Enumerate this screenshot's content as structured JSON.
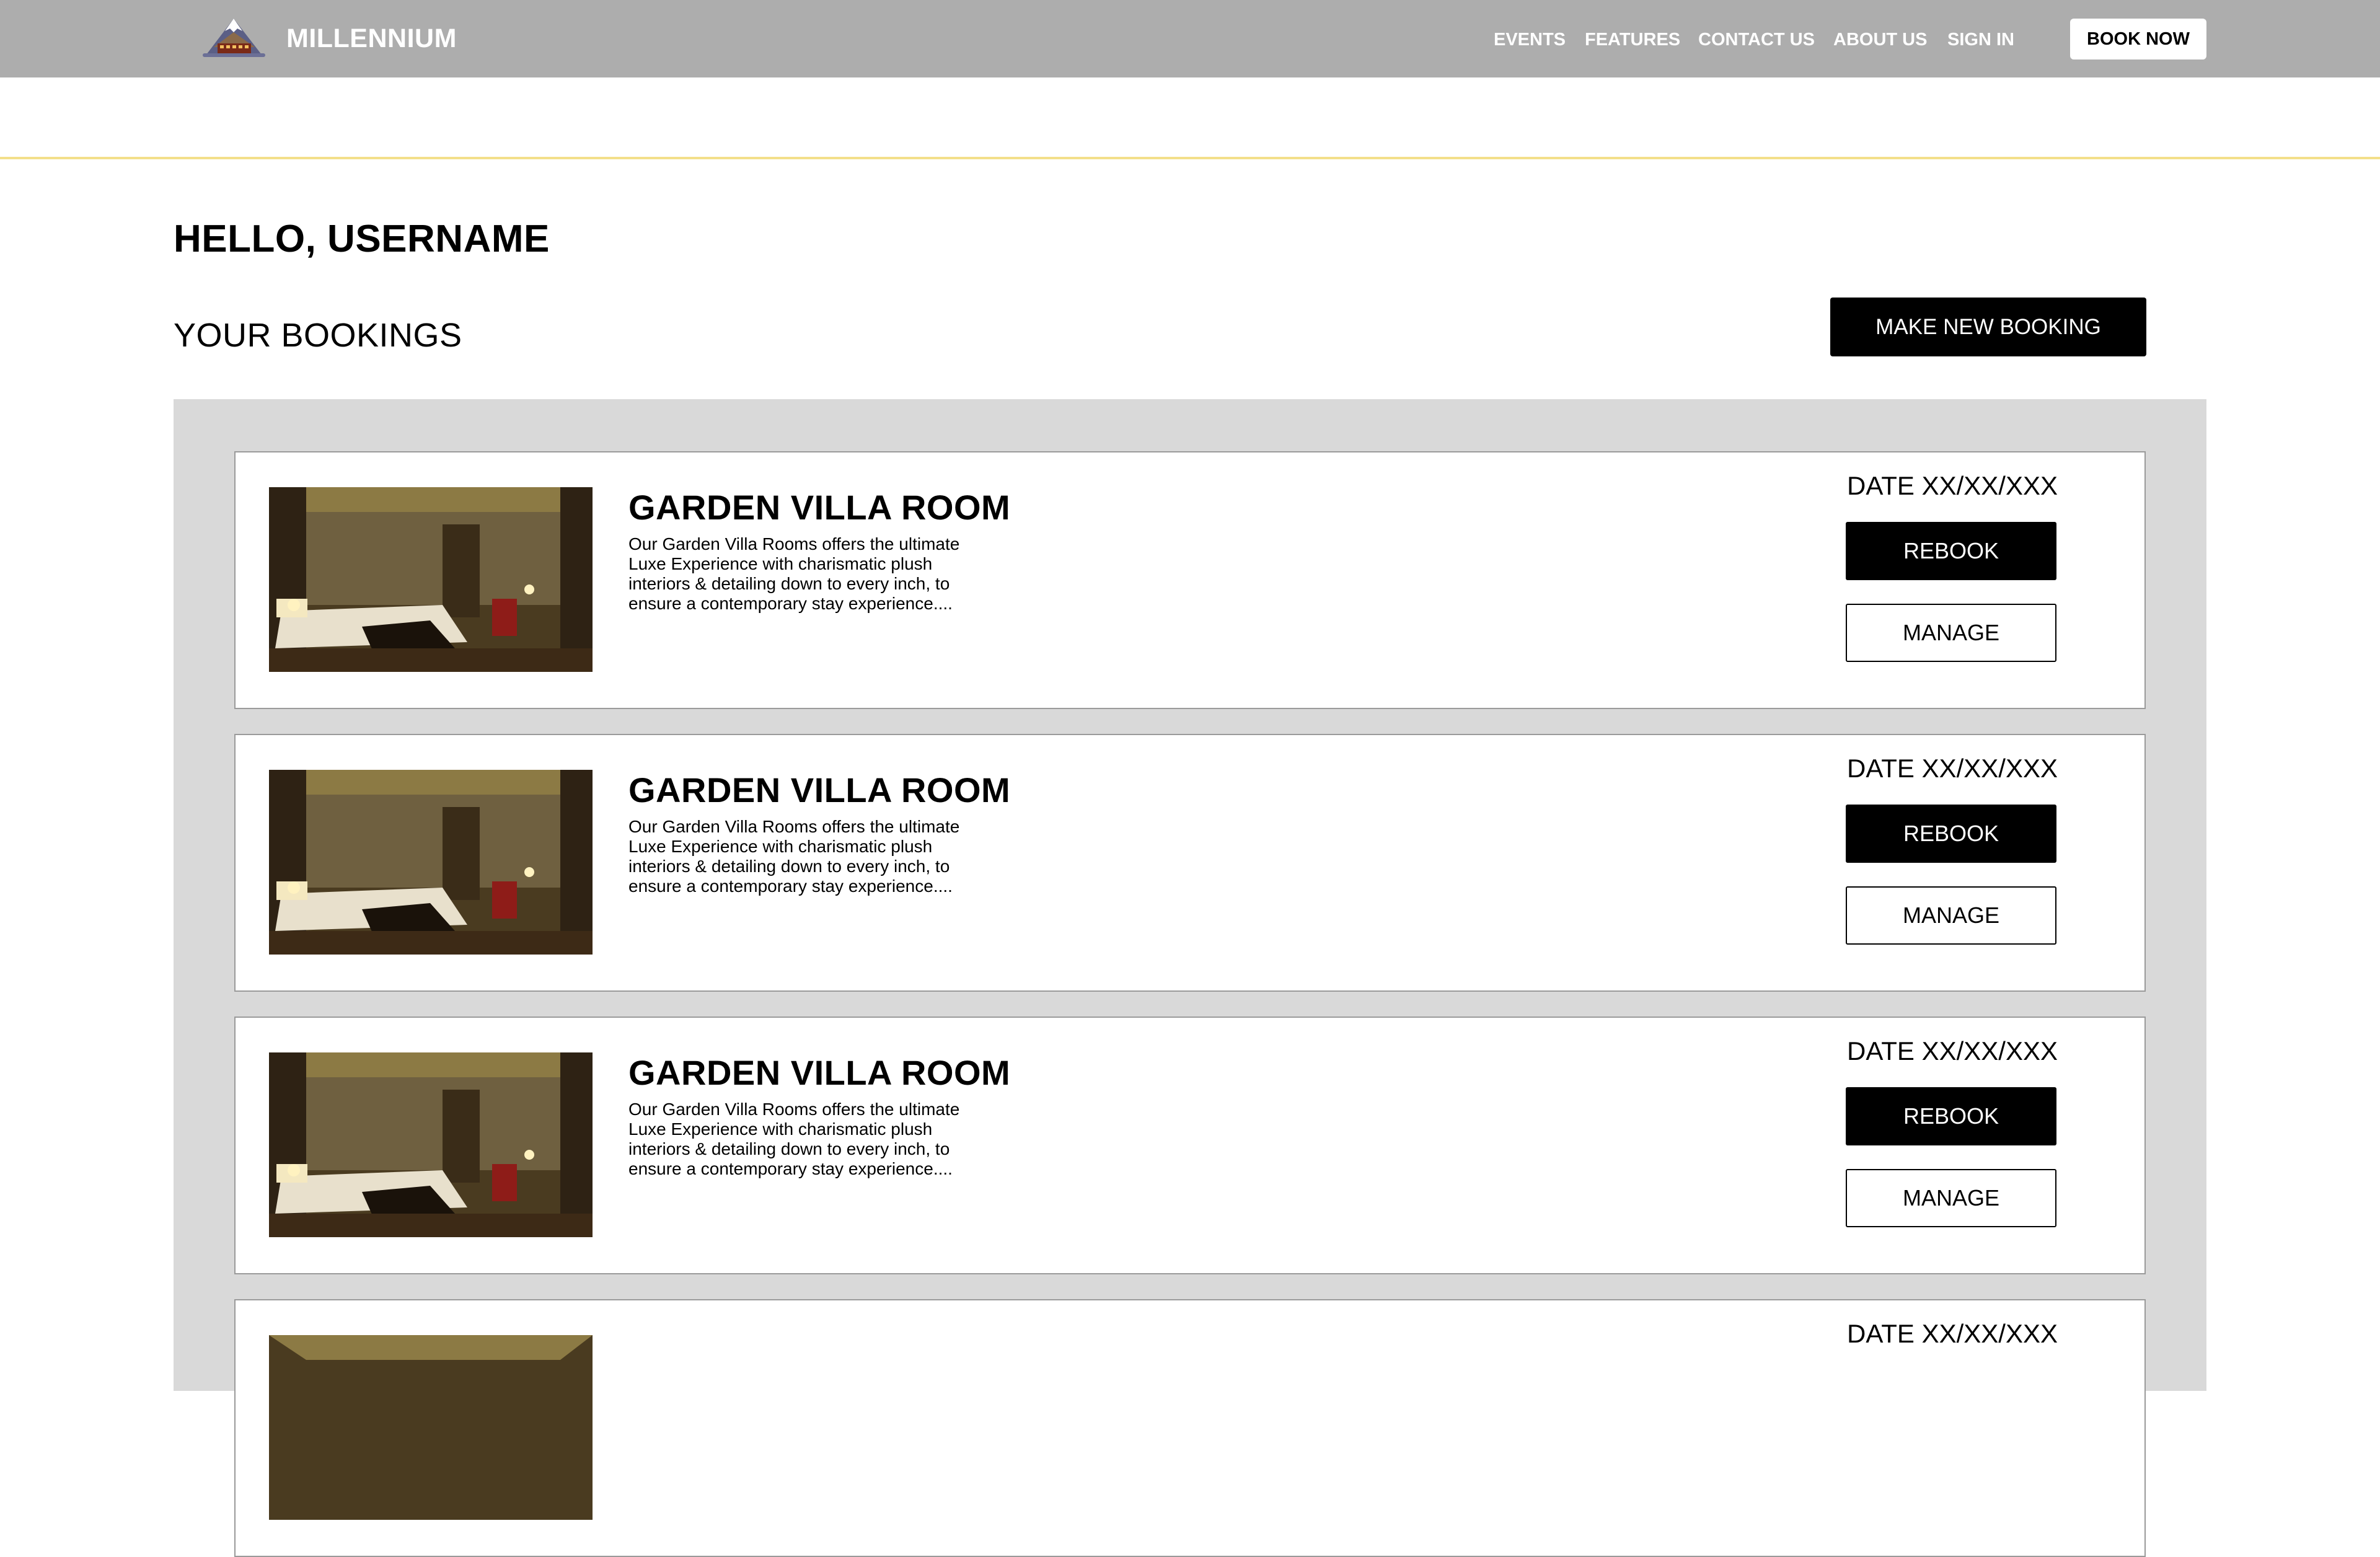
{
  "header": {
    "brand": "MILLENNIUM",
    "nav": [
      "EVENTS",
      "FEATURES",
      "CONTACT US",
      "ABOUT US",
      "SIGN IN"
    ],
    "book_now": "BOOK NOW"
  },
  "greeting": "HELLO, USERNAME",
  "bookings": {
    "title": "YOUR BOOKINGS",
    "new_booking_label": "MAKE NEW BOOKING",
    "items": [
      {
        "title": "GARDEN VILLA ROOM",
        "description": "Our Garden Villa Rooms offers the ultimate Luxe Experience with charismatic plush interiors & detailing down to every inch, to ensure a contemporary stay experience....",
        "date": "DATE XX/XX/XXX",
        "rebook_label": "REBOOK",
        "manage_label": "MANAGE"
      },
      {
        "title": "GARDEN VILLA ROOM",
        "description": "Our Garden Villa Rooms offers the ultimate Luxe Experience with charismatic plush interiors & detailing down to every inch, to ensure a contemporary stay experience....",
        "date": "DATE XX/XX/XXX",
        "rebook_label": "REBOOK",
        "manage_label": "MANAGE"
      },
      {
        "title": "GARDEN VILLA ROOM",
        "description": "Our Garden Villa Rooms offers the ultimate Luxe Experience with charismatic plush interiors & detailing down to every inch, to ensure a contemporary stay experience....",
        "date": "DATE XX/XX/XXX",
        "rebook_label": "REBOOK",
        "manage_label": "MANAGE"
      },
      {
        "title": "",
        "description": "",
        "date": "DATE XX/XX/XXX",
        "rebook_label": "",
        "manage_label": ""
      }
    ]
  },
  "colors": {
    "navbar": "#adadad",
    "panel": "#d9d9d9",
    "divider": "#f3df8a",
    "primary_button": "#000000"
  },
  "icons": {
    "logo": "hotel-mountain-logo-icon"
  }
}
